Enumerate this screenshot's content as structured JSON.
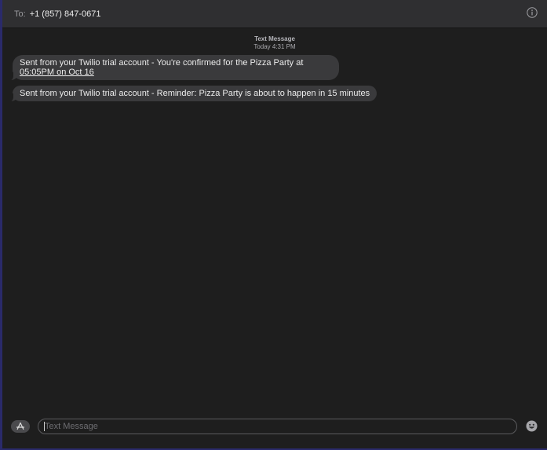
{
  "header": {
    "to_label": "To:",
    "recipient": "+1 (857) 847-0671",
    "info_icon": "info-circle-icon"
  },
  "thread": {
    "service": "Text Message",
    "timestamp": "Today 4:31 PM",
    "messages": [
      {
        "text_before": "Sent from your Twilio trial account - You're confirmed for the Pizza Party at ",
        "link": "05:05PM on Oct 16",
        "text_after": ""
      },
      {
        "text_before": "Sent from your Twilio trial account - Reminder: Pizza Party is about to happen in 15 minutes",
        "link": "",
        "text_after": ""
      }
    ]
  },
  "composer": {
    "placeholder": "Text Message",
    "value": "",
    "apps_icon": "app-store-icon",
    "emoji_icon": "emoji-icon"
  },
  "colors": {
    "background": "#1e1e1e",
    "header": "#2f2f31",
    "bubble": "#3a3a3c",
    "text": "#ececec"
  }
}
